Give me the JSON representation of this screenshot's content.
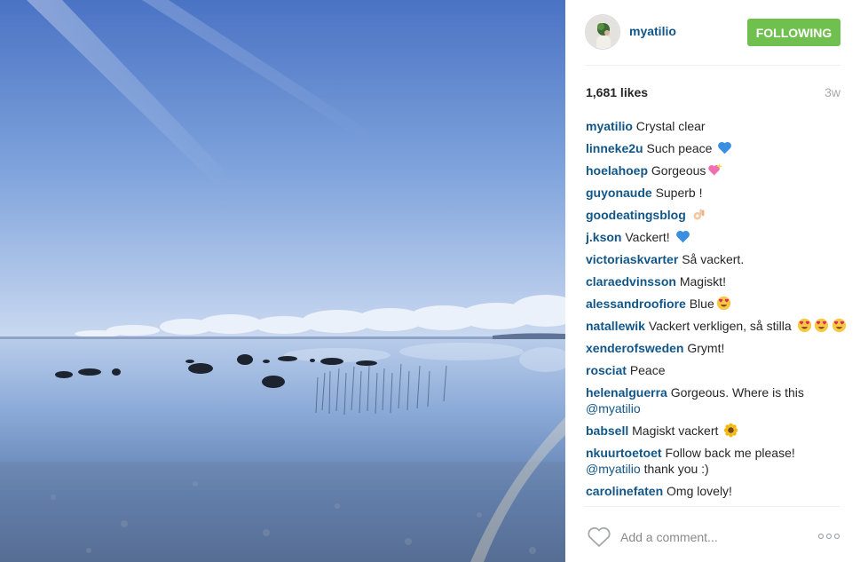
{
  "post": {
    "username": "myatilio",
    "follow_label": "FOLLOWING",
    "likes": "1,681 likes",
    "time_ago": "3w",
    "add_comment_placeholder": "Add a comment..."
  },
  "comments": [
    {
      "user": "myatilio",
      "text": "Crystal clear",
      "emoji": ""
    },
    {
      "user": "linneke2u",
      "text": "Such peace",
      "emoji": "blue-heart-emoji"
    },
    {
      "user": "hoelahoep",
      "text": "Gorgeous",
      "emoji": "sparkling-heart-emoji"
    },
    {
      "user": "guyonaude",
      "text": "Superb !",
      "emoji": ""
    },
    {
      "user": "goodeatingsblog",
      "text": "",
      "emoji": "ok-hand-emoji"
    },
    {
      "user": "j.kson",
      "text": "Vackert!",
      "emoji": "blue-heart-emoji"
    },
    {
      "user": "victoriaskvarter",
      "text": "Så vackert.",
      "emoji": ""
    },
    {
      "user": "claraedvinsson",
      "text": "Magiskt!",
      "emoji": ""
    },
    {
      "user": "alessandroofiore",
      "text": "Blue",
      "emoji": "heart-eyes-emoji"
    },
    {
      "user": "natallewik",
      "text": "Vackert verkligen, så stilla",
      "emoji": "heart-eyes-emoji",
      "emoji_count": 3
    },
    {
      "user": "xenderofsweden",
      "text": "Grymt!",
      "emoji": ""
    },
    {
      "user": "rosciat",
      "text": "Peace",
      "emoji": ""
    },
    {
      "user": "helenalguerra",
      "text": "Gorgeous. Where is this",
      "mention": "@myatilio",
      "emoji": ""
    },
    {
      "user": "babsell",
      "text": "Magiskt vackert",
      "emoji": "sunflower-emoji"
    },
    {
      "user": "nkuurtoetoet",
      "text": "Follow back me please!",
      "mention": "@myatilio",
      "after_mention": "thank you :)",
      "emoji": ""
    },
    {
      "user": "carolinefaten",
      "text": "Omg lovely!",
      "emoji": ""
    }
  ],
  "colors": {
    "follow_green": "#70c050",
    "username_blue": "#125688"
  }
}
